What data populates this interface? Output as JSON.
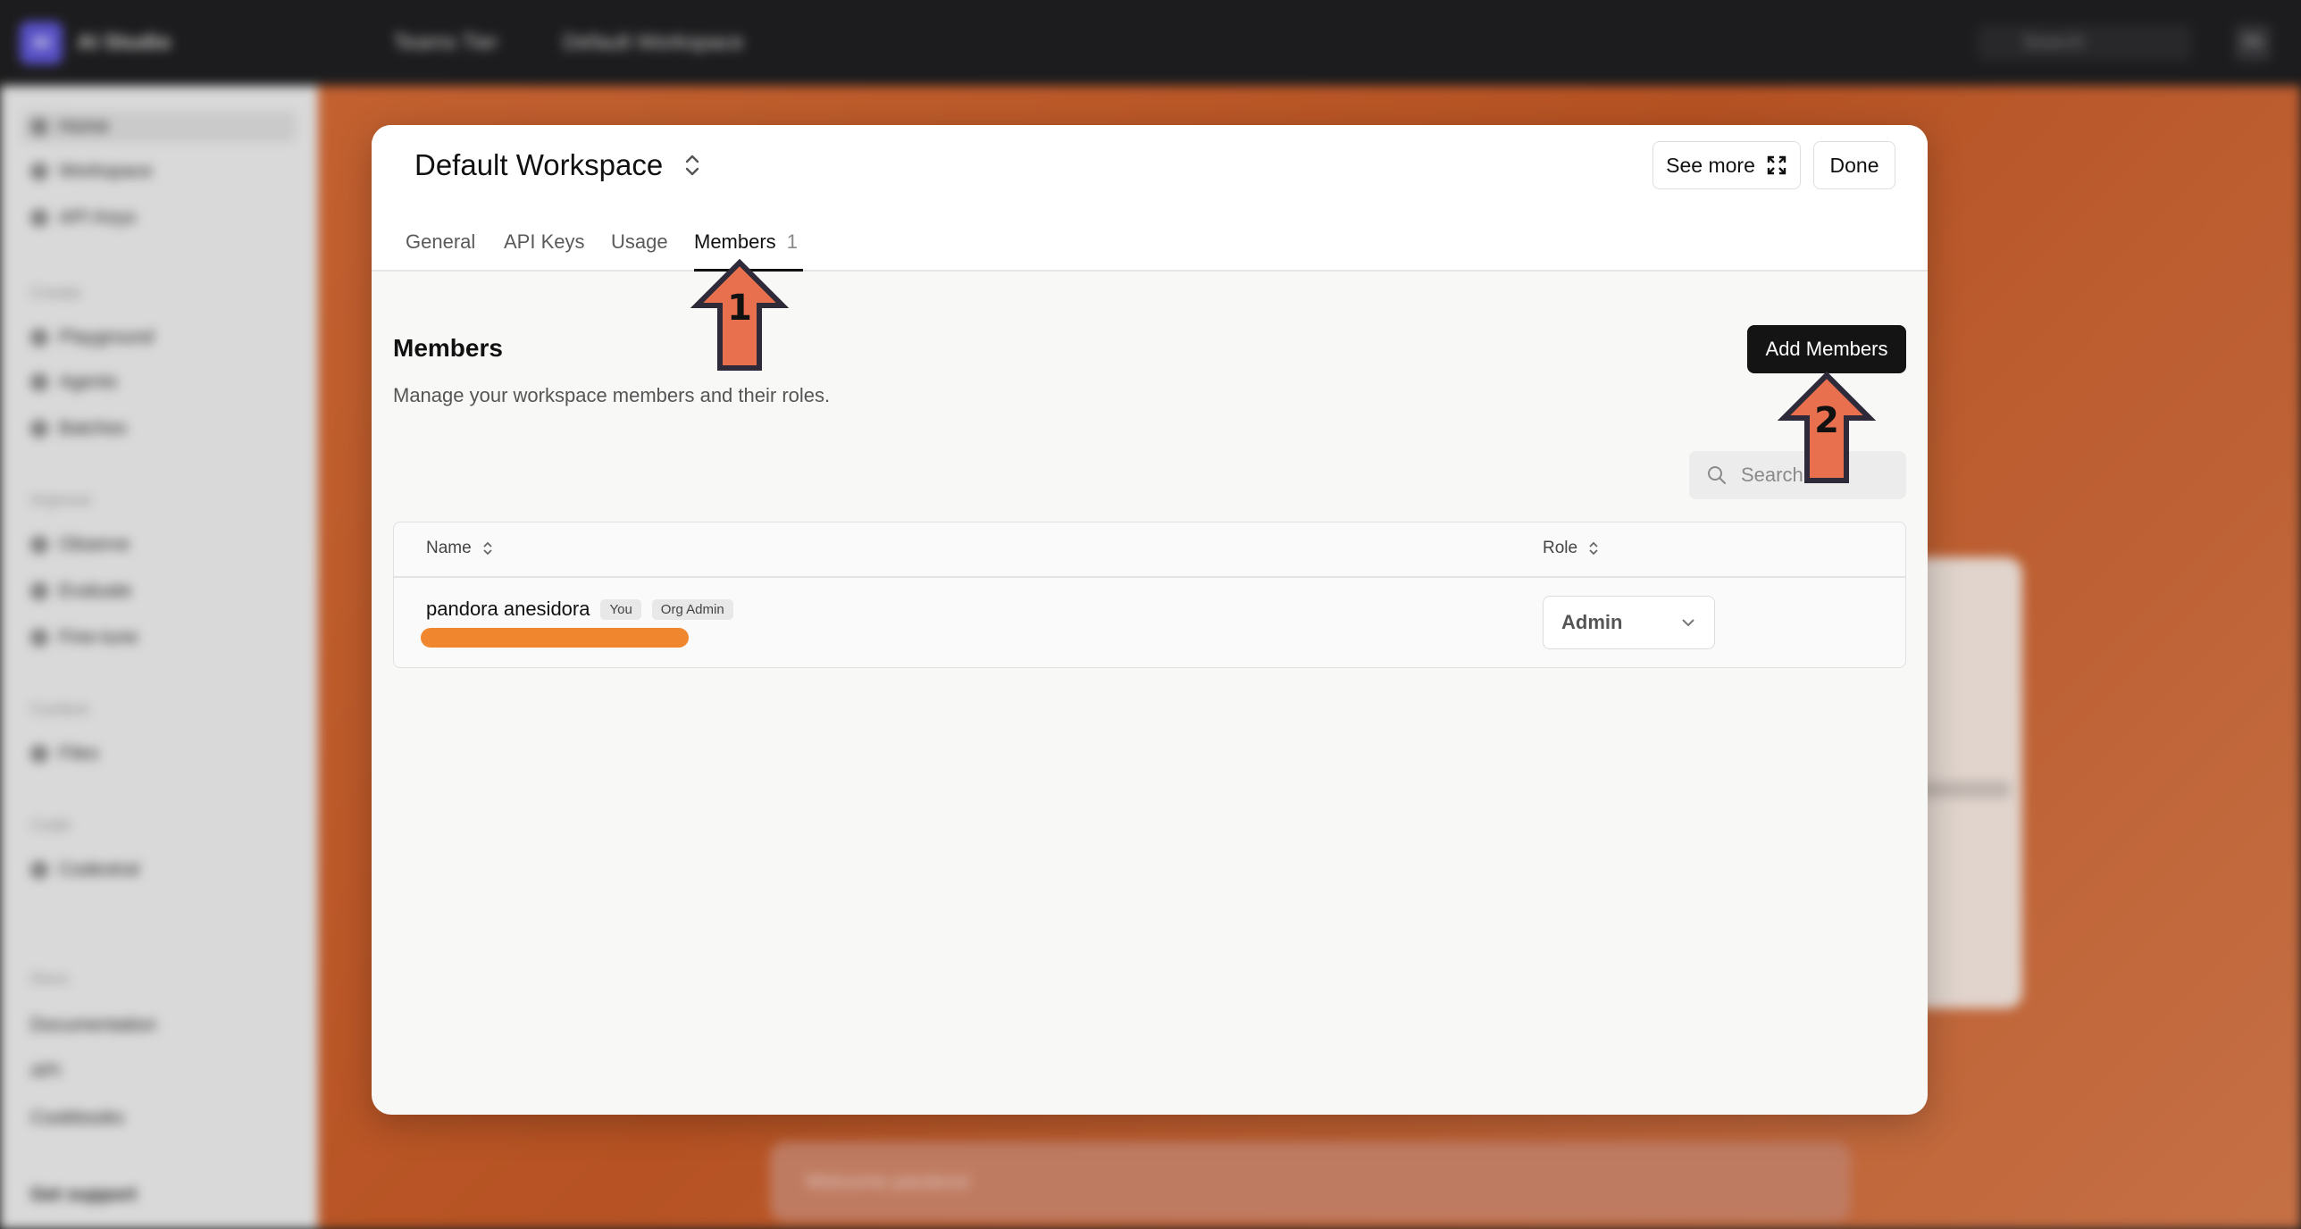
{
  "topbar": {
    "logo": "AI",
    "app_name": "AI Studio",
    "team": "Teams Tier",
    "workspace": "Default Workspace",
    "search_placeholder": "Search",
    "avatar": "PA"
  },
  "sidebar": {
    "items_top": [
      "Home",
      "Workspace",
      "API Keys"
    ],
    "create_header": "Create",
    "create_items": [
      "Playground",
      "Agents",
      "Batches"
    ],
    "improve_header": "Improve",
    "improve_items": [
      "Observe",
      "Evaluate",
      "Fine-tune"
    ],
    "context_header": "Context",
    "context_items": [
      "Files"
    ],
    "code_header": "Code",
    "code_items": [
      "Codestral"
    ],
    "docs_header": "Docs",
    "docs_items": [
      "Documentation",
      "API",
      "Cookbooks"
    ],
    "support": "Get support"
  },
  "bg": {
    "toast": "Welcome pandora!"
  },
  "modal": {
    "workspace_title": "Default Workspace",
    "see_more_label": "See more",
    "done_label": "Done",
    "tabs": [
      {
        "label": "General"
      },
      {
        "label": "API Keys"
      },
      {
        "label": "Usage"
      },
      {
        "label": "Members",
        "count": "1"
      }
    ],
    "section_title": "Members",
    "section_desc": "Manage your workspace members and their roles.",
    "add_members_label": "Add Members",
    "search_placeholder": "Search",
    "table": {
      "col_name": "Name",
      "col_role": "Role",
      "rows": [
        {
          "name": "pandora anesidora",
          "badges": [
            "You",
            "Org Admin"
          ],
          "role": "Admin"
        }
      ]
    }
  },
  "markers": [
    "1",
    "2"
  ],
  "colors": {
    "accent_orange": "#f0872e",
    "primary_button": "#141414",
    "marker_fill": "#e8704f"
  }
}
